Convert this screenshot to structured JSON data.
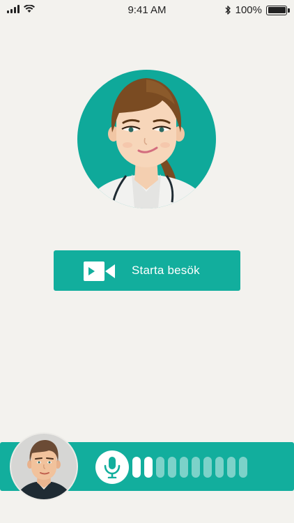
{
  "status_bar": {
    "time": "9:41 AM",
    "battery": "100%",
    "icons": [
      "signal-icon",
      "wifi-icon",
      "bluetooth-icon",
      "battery-icon"
    ]
  },
  "doctor": {
    "avatar_icon": "doctor-avatar"
  },
  "start_button": {
    "label": "Starta besök",
    "icon": "video-camera-icon"
  },
  "call_bar": {
    "patient_avatar_icon": "patient-avatar",
    "mic_icon": "microphone-icon",
    "level_total": 10,
    "level_active": 2
  },
  "colors": {
    "accent": "#12ae9d",
    "background": "#f3f2ee"
  }
}
